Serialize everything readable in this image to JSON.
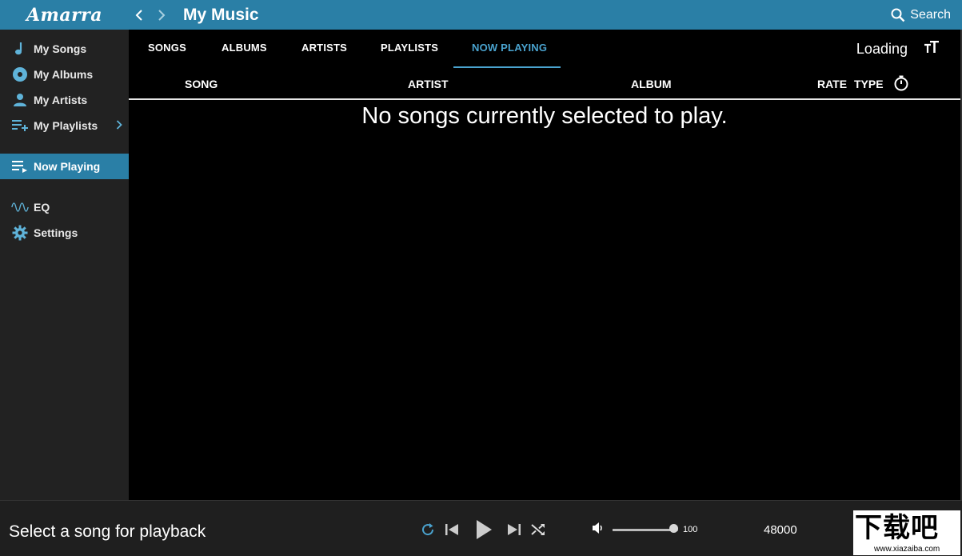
{
  "window": {
    "brand": "Amarra",
    "title": "My Music",
    "search_label": "Search"
  },
  "sidebar": {
    "items": [
      {
        "label": "My Songs",
        "icon": "music-note-icon"
      },
      {
        "label": "My Albums",
        "icon": "disc-icon"
      },
      {
        "label": "My Artists",
        "icon": "person-icon"
      },
      {
        "label": "My Playlists",
        "icon": "playlist-add-icon"
      },
      {
        "label": "Now Playing",
        "icon": "queue-icon"
      },
      {
        "label": "EQ",
        "icon": "waveform-icon"
      },
      {
        "label": "Settings",
        "icon": "gear-icon"
      }
    ],
    "active": "Now Playing"
  },
  "tabs": {
    "items": [
      "SONGS",
      "ALBUMS",
      "ARTISTS",
      "PLAYLISTS",
      "NOW PLAYING"
    ],
    "active": "NOW PLAYING"
  },
  "header": {
    "status": "Loading"
  },
  "table": {
    "columns": [
      "SONG",
      "ARTIST",
      "ALBUM",
      "RATE",
      "TYPE"
    ],
    "empty_message": "No songs currently selected to play."
  },
  "player": {
    "now_playing_text": "Select a song for playback",
    "volume": 100,
    "volume_label": "100",
    "sample_rate": "48000"
  },
  "watermark": {
    "main": "下载吧",
    "sub": "www.xiazaiba.com"
  },
  "colors": {
    "accent": "#2a7fa6",
    "accent_light": "#4aa3cf",
    "sidebar_bg": "#222222",
    "main_bg": "#000000",
    "bottom_bg": "#1f1f1f"
  }
}
